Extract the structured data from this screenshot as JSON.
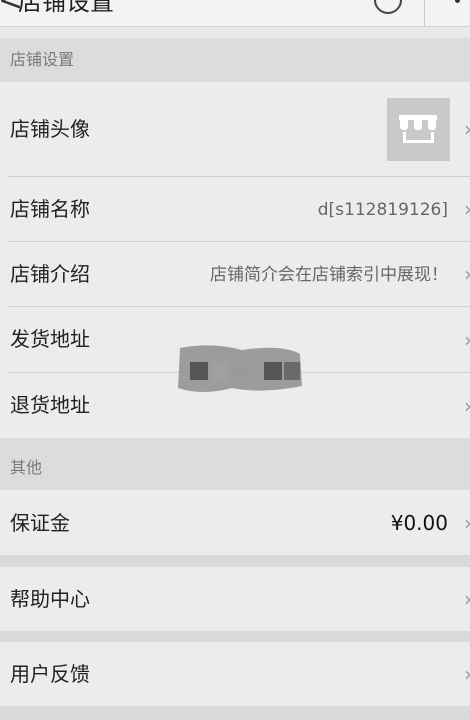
{
  "topbar": {
    "back_glyph": "<",
    "title": "店铺设置",
    "help_icon": "help-circle-icon",
    "more_icon": "more-vertical-icon"
  },
  "sections": {
    "shop_settings": {
      "header": "店铺设置",
      "items": [
        {
          "label": "店铺头像",
          "value": ""
        },
        {
          "label": "店铺名称",
          "value": "d[s112819126]"
        },
        {
          "label": "店铺介绍",
          "value": "店铺简介会在店铺索引中展现！"
        },
        {
          "label": "发货地址",
          "value": ""
        },
        {
          "label": "退货地址",
          "value": ""
        }
      ]
    },
    "other": {
      "header": "其他",
      "items": [
        {
          "label": "保证金",
          "value": "¥0.00"
        }
      ]
    }
  },
  "help_center": {
    "label": "帮助中心"
  },
  "feedback": {
    "label": "用户反馈"
  },
  "chevron_glyph": "›",
  "colors": {
    "page_bg": "#e9e9e9",
    "section_header_bg": "#dcdcdc",
    "muted_text": "#7a7a7a"
  }
}
